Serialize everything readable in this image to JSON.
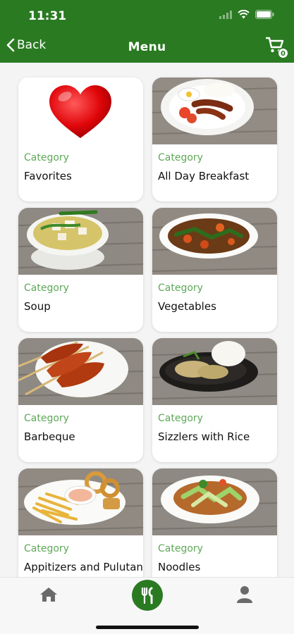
{
  "status_bar": {
    "time": "11:31"
  },
  "nav": {
    "back_label": "Back",
    "title": "Menu",
    "cart_count": "0"
  },
  "colors": {
    "brand_green": "#2a7a22",
    "category_green": "#5ea857"
  },
  "categories": [
    {
      "caption": "Category",
      "name": "Favorites",
      "image": "heart"
    },
    {
      "caption": "Category",
      "name": "All Day Breakfast",
      "image": "breakfast-plate"
    },
    {
      "caption": "Category",
      "name": "Soup",
      "image": "soup-bowl"
    },
    {
      "caption": "Category",
      "name": "Vegetables",
      "image": "vegetable-dish"
    },
    {
      "caption": "Category",
      "name": "Barbeque",
      "image": "bbq-skewers"
    },
    {
      "caption": "Category",
      "name": "Sizzlers with Rice",
      "image": "sizzler-plate"
    },
    {
      "caption": "Category",
      "name": "Appitizers and Pulutan",
      "image": "fries-platter"
    },
    {
      "caption": "Category",
      "name": "Noodles",
      "image": "noodle-plate"
    }
  ],
  "bottom_nav": {
    "items": [
      "home-icon",
      "utensils-icon",
      "user-icon"
    ],
    "active": "utensils-icon"
  }
}
